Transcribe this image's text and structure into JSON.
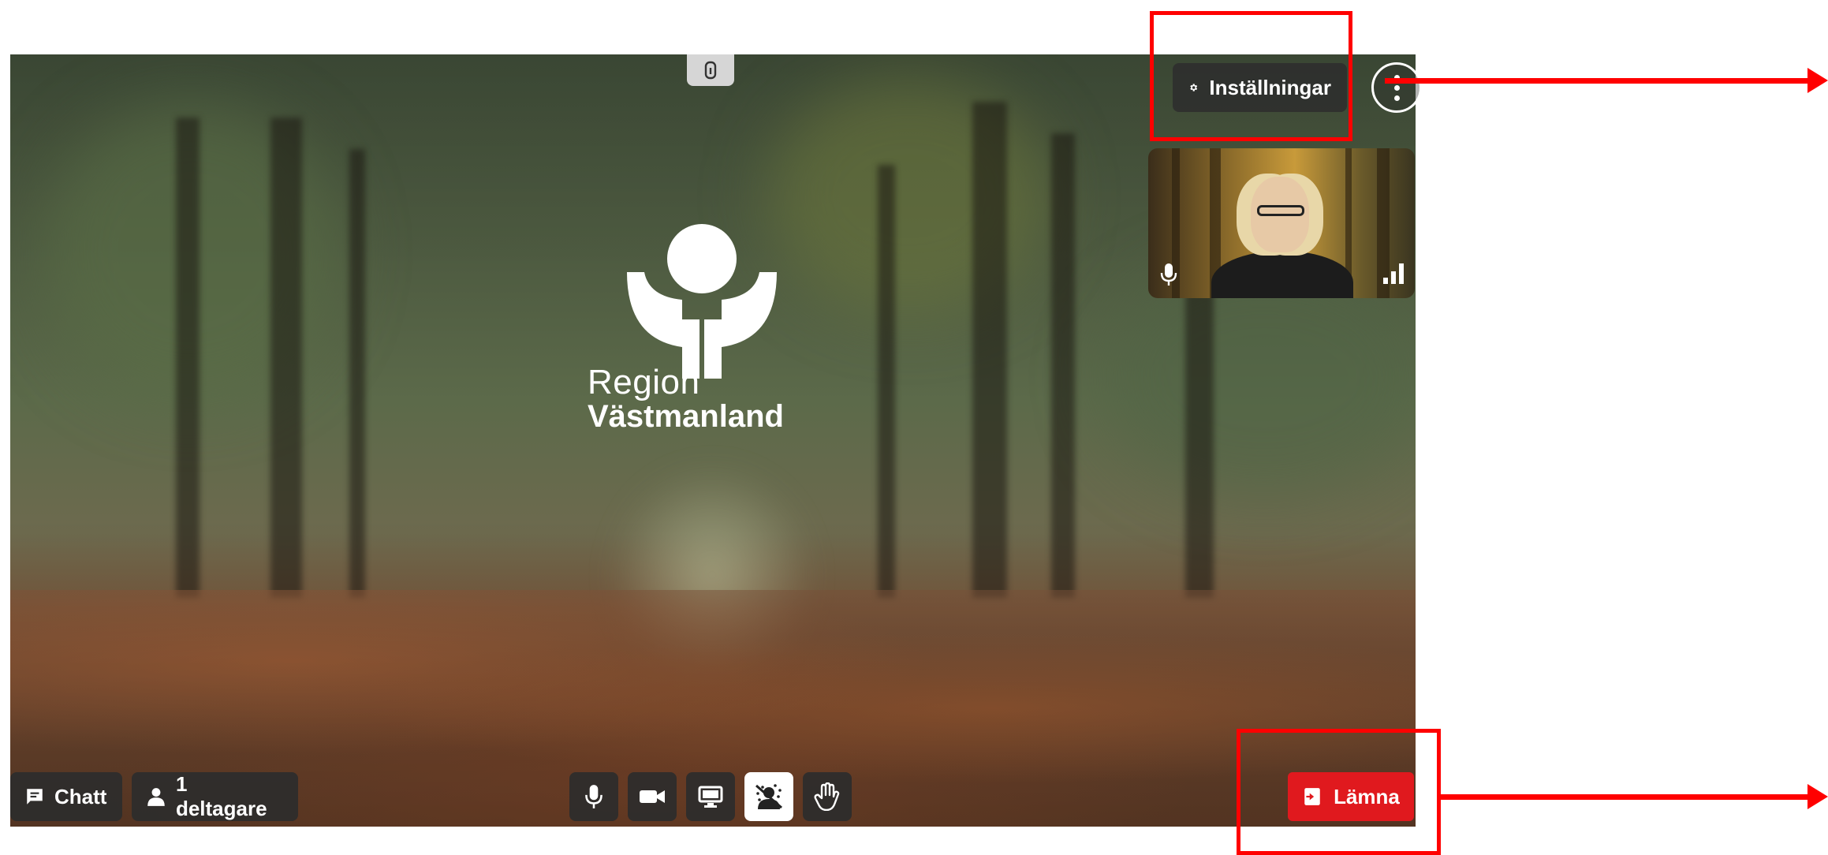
{
  "settings": {
    "label": "Inställningar"
  },
  "logo": {
    "line1": "Region",
    "line2": "Västmanland"
  },
  "bottom_bar": {
    "chat_label": "Chatt",
    "participants_label": "1 deltagare",
    "leave_label": "Lämna"
  },
  "controls": [
    "microphone-icon",
    "camera-icon",
    "screen-share-icon",
    "background-blur-icon",
    "raise-hand-icon"
  ],
  "colors": {
    "leave": "#e0191e",
    "annotation": "#ff0000"
  }
}
